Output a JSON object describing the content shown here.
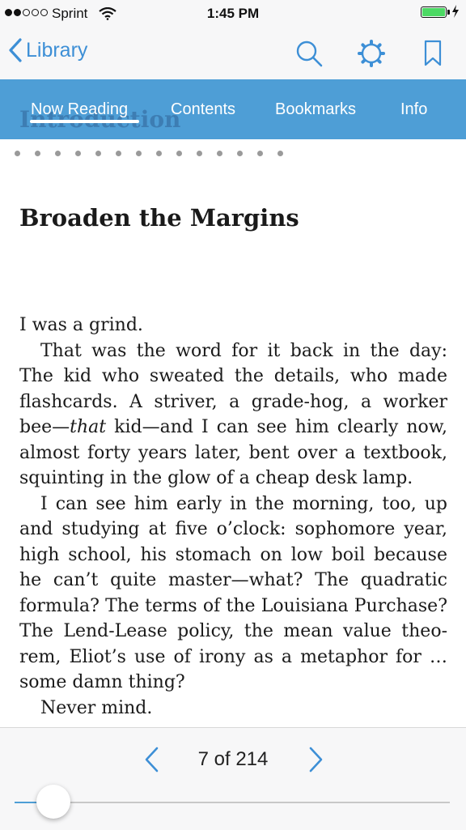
{
  "status_bar": {
    "carrier": "Sprint",
    "time": "1:45 PM",
    "signal_bars_filled": 2,
    "signal_bars_total": 5,
    "battery_level": 1.0
  },
  "nav": {
    "back_label": "Library",
    "icons": [
      "search-icon",
      "settings-icon",
      "bookmark-icon"
    ],
    "accent": "#3d8fd6"
  },
  "tabs": {
    "background": "#4e9ed6",
    "ghost_text": "Introduction",
    "items": [
      {
        "label": "Now Reading",
        "active": true
      },
      {
        "label": "Contents",
        "active": false
      },
      {
        "label": "Bookmarks",
        "active": false
      },
      {
        "label": "Info",
        "active": false
      }
    ]
  },
  "reader": {
    "chapter_title": "Broaden the Margins",
    "paragraphs": {
      "p1": "I was a grind.",
      "p2_before": "That was the word for it back in the day: The kid who sweated the details, who made flashcards. A striver, a grade-hog, a worker bee—",
      "p2_em": "that",
      "p2_after": " kid—and I can see him clearly now, almost forty years later, bent over a textbook, squinting in the glow of a cheap desk lamp.",
      "p3": "I can see him early in the morning, too, up and studying at five o’clock: sophomore year, high school, his stomach on low boil because he can’t quite master—what? The quadratic formula? The terms of the Louisiana Purchase? The Lend-Lease policy, the mean value theo­rem, Eliot’s use of irony as a metaphor for … some damn thing?",
      "p4": "Never mind."
    }
  },
  "pager": {
    "page_label": "7 of 214",
    "current_page": 7,
    "total_pages": 214
  }
}
